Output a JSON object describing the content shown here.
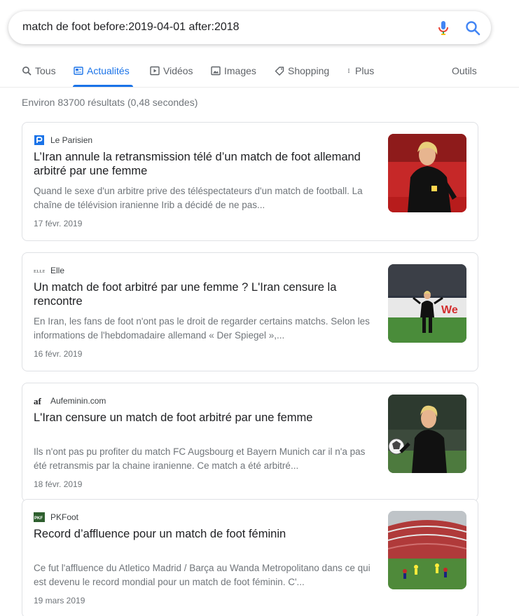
{
  "search": {
    "query": "match de foot before:2019-04-01 after:2018"
  },
  "tabs": [
    {
      "label": "Tous",
      "icon": "search-icon"
    },
    {
      "label": "Actualités",
      "icon": "newspaper-icon"
    },
    {
      "label": "Vidéos",
      "icon": "play-icon"
    },
    {
      "label": "Images",
      "icon": "image-icon"
    },
    {
      "label": "Shopping",
      "icon": "tag-icon"
    },
    {
      "label": "Plus",
      "icon": "more-vertical-icon"
    },
    {
      "label": "Outils"
    }
  ],
  "result_stats": "Environ 83700 résultats (0,48 secondes)",
  "colors": {
    "accent": "#1a73e8",
    "text": "#202124",
    "muted": "#70757a",
    "border": "#dfe1e5"
  },
  "results": [
    {
      "source": "Le Parisien",
      "source_logo": "le-parisien-logo",
      "title": "L’Iran annule la retransmission télé d’un match de foot allemand arbitré par une femme",
      "snippet": "Quand le sexe d'un arbitre prive des téléspectateurs d'un match de football. La chaîne de télévision iranienne Irib a décidé de ne pas...",
      "date": "17 févr. 2019"
    },
    {
      "source": "Elle",
      "source_logo": "elle-logo",
      "title": "Un match de foot arbitré par une femme ? L'Iran censure la rencontre",
      "snippet": "En Iran, les fans de foot n'ont pas le droit de regarder certains matchs. Selon les informations de l'hebdomadaire allemand « Der Spiegel »,...",
      "date": "16 févr. 2019"
    },
    {
      "source": "Aufeminin.com",
      "source_logo": "aufeminin-logo",
      "title": "L'Iran censure un match de foot arbitré par une femme",
      "snippet": "Ils n'ont pas pu profiter du match FC Augsbourg et Bayern Munich car il n'a pas été retransmis par la chaine iranienne. Ce match a été arbitré...",
      "date": "18 févr. 2019"
    },
    {
      "source": "PKFoot",
      "source_logo": "pkfoot-logo",
      "title": "Record d’affluence pour un match de foot féminin",
      "snippet": "Ce fut l'affluence du Atletico Madrid / Barça au Wanda Metropolitano dans ce qui est devenu le record mondial pour un match de foot féminin. C'...",
      "date": "19 mars 2019"
    }
  ]
}
